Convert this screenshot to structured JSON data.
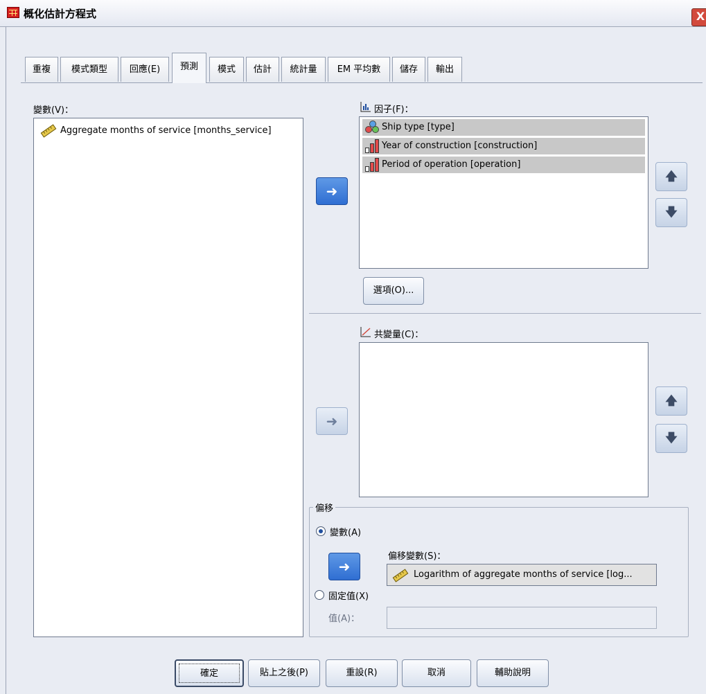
{
  "window": {
    "title": "概化估計方程式",
    "close_label": "X"
  },
  "tabs": [
    {
      "label": "重複",
      "active": false
    },
    {
      "label": "模式類型",
      "active": false
    },
    {
      "label": "回應(E)",
      "active": false
    },
    {
      "label": "預測",
      "active": true
    },
    {
      "label": "模式",
      "active": false
    },
    {
      "label": "估計",
      "active": false
    },
    {
      "label": "統計量",
      "active": false
    },
    {
      "label": "EM 平均數",
      "active": false
    },
    {
      "label": "儲存",
      "active": false
    },
    {
      "label": "輸出",
      "active": false
    }
  ],
  "variables": {
    "label": "變數(V)：",
    "items": [
      {
        "text": "Aggregate months of service [months_service]",
        "icon": "scale-ruler-icon"
      }
    ]
  },
  "factors": {
    "label": "因子(F)：",
    "header_icon": "factor-icon",
    "items": [
      {
        "text": "Ship type [type]",
        "icon": "nominal-icon"
      },
      {
        "text": "Year of construction [construction]",
        "icon": "ordinal-icon"
      },
      {
        "text": "Period of operation [operation]",
        "icon": "ordinal-icon"
      }
    ],
    "options_button": "選項(O)..."
  },
  "covariates": {
    "label": "共變量(C)：",
    "header_icon": "covariate-icon",
    "items": []
  },
  "offset": {
    "group_title": "偏移",
    "variable_radio": "變數(A)",
    "variable_checked": true,
    "offset_variable_label": "偏移變數(S)：",
    "offset_variable_value": "Logarithm of aggregate months of service [log...",
    "fixed_radio": "固定值(X)",
    "fixed_checked": false,
    "value_label": "值(A)：",
    "value": ""
  },
  "icons": {
    "move_left": "arrow-left-icon",
    "move_right": "arrow-right-icon",
    "up": "arrow-up-icon",
    "down": "arrow-down-icon"
  },
  "buttons": {
    "ok": "確定",
    "paste": "貼上之後(P)",
    "reset": "重設(R)",
    "cancel": "取消",
    "help": "輔助說明"
  }
}
